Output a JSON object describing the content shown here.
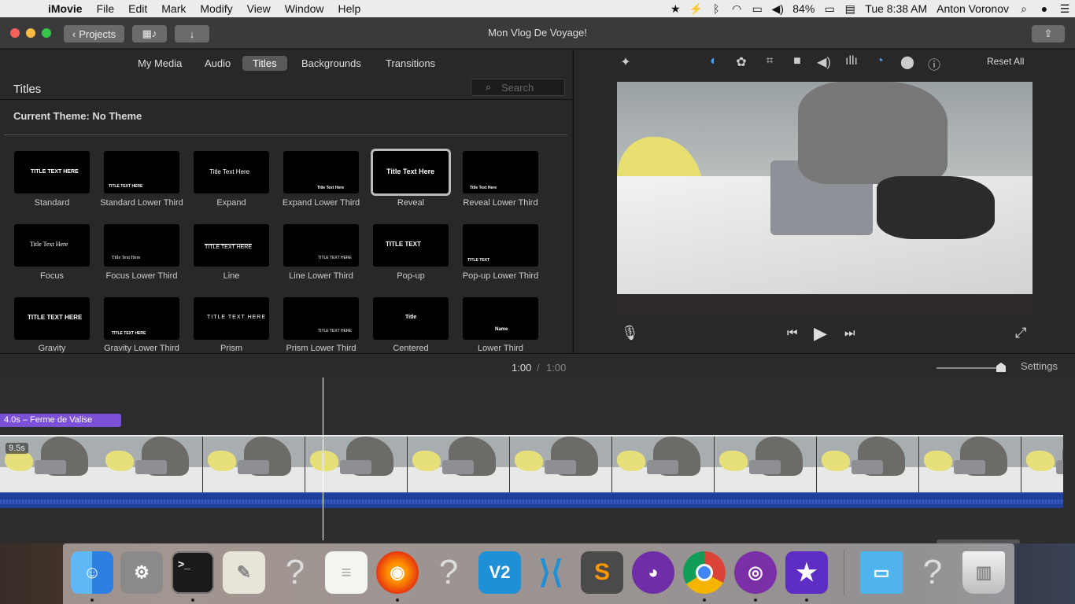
{
  "menubar": {
    "app": "iMovie",
    "menus": [
      "File",
      "Edit",
      "Mark",
      "Modify",
      "View",
      "Window",
      "Help"
    ],
    "battery": "84%",
    "clock": "Tue 8:38 AM",
    "user": "Anton Voronov"
  },
  "toolbar": {
    "projects_label": "Projects",
    "window_title": "Mon Vlog De Voyage!"
  },
  "browser": {
    "tabs": [
      "My Media",
      "Audio",
      "Titles",
      "Backgrounds",
      "Transitions"
    ],
    "active_tab": "Titles",
    "panel_title": "Titles",
    "search_placeholder": "Search",
    "current_theme": "Current Theme: No Theme",
    "titles": [
      {
        "label": "Standard",
        "preview": "TITLE TEXT HERE"
      },
      {
        "label": "Standard Lower Third",
        "preview": "TITLE TEXT HERE"
      },
      {
        "label": "Expand",
        "preview": "Title Text Here"
      },
      {
        "label": "Expand Lower Third",
        "preview": "Title Text Here"
      },
      {
        "label": "Reveal",
        "preview": "Title Text Here"
      },
      {
        "label": "Reveal Lower Third",
        "preview": "Title Text Here"
      },
      {
        "label": "Focus",
        "preview": "Title Text Here"
      },
      {
        "label": "Focus Lower Third",
        "preview": "Title Text Here"
      },
      {
        "label": "Line",
        "preview": "TITLE TEXT HERE"
      },
      {
        "label": "Line Lower Third",
        "preview": "TITLE TEXT HERE"
      },
      {
        "label": "Pop-up",
        "preview": "TITLE TEXT"
      },
      {
        "label": "Pop-up Lower Third",
        "preview": "TITLE TEXT"
      },
      {
        "label": "Gravity",
        "preview": "TITLE TEXT HERE"
      },
      {
        "label": "Gravity Lower Third",
        "preview": "TITLE TEXT HERE"
      },
      {
        "label": "Prism",
        "preview": "TITLE TEXT HERE"
      },
      {
        "label": "Prism Lower Third",
        "preview": "TITLE TEXT HERE"
      },
      {
        "label": "Centered",
        "preview": "Title"
      },
      {
        "label": "Lower Third",
        "preview": "Name"
      }
    ],
    "selected_title": "Reveal"
  },
  "viewer": {
    "reset_label": "Reset All"
  },
  "timeline": {
    "current_time": "1:00",
    "separator": "/",
    "total_time": "1:00",
    "settings_label": "Settings",
    "title_clip": "4.0s – Ferme de Valise",
    "clip_duration": "9.5s"
  },
  "colors": {
    "title_clip": "#7b4fd6",
    "audio_track": "#1f3f9a",
    "selected_tab": "#5a5a5a"
  },
  "dock": {
    "apps": [
      "finder-icon",
      "system-preferences-icon",
      "terminal-icon",
      "script-editor-icon",
      "unknown-app-icon",
      "textedit-icon",
      "firefox-icon",
      "unknown-app-icon",
      "vnc-viewer-icon",
      "vscode-icon",
      "sublime-text-icon",
      "github-desktop-icon",
      "chrome-icon",
      "tor-browser-icon",
      "imovie-icon",
      "downloads-folder-icon",
      "unknown-app-icon",
      "trash-icon"
    ]
  }
}
